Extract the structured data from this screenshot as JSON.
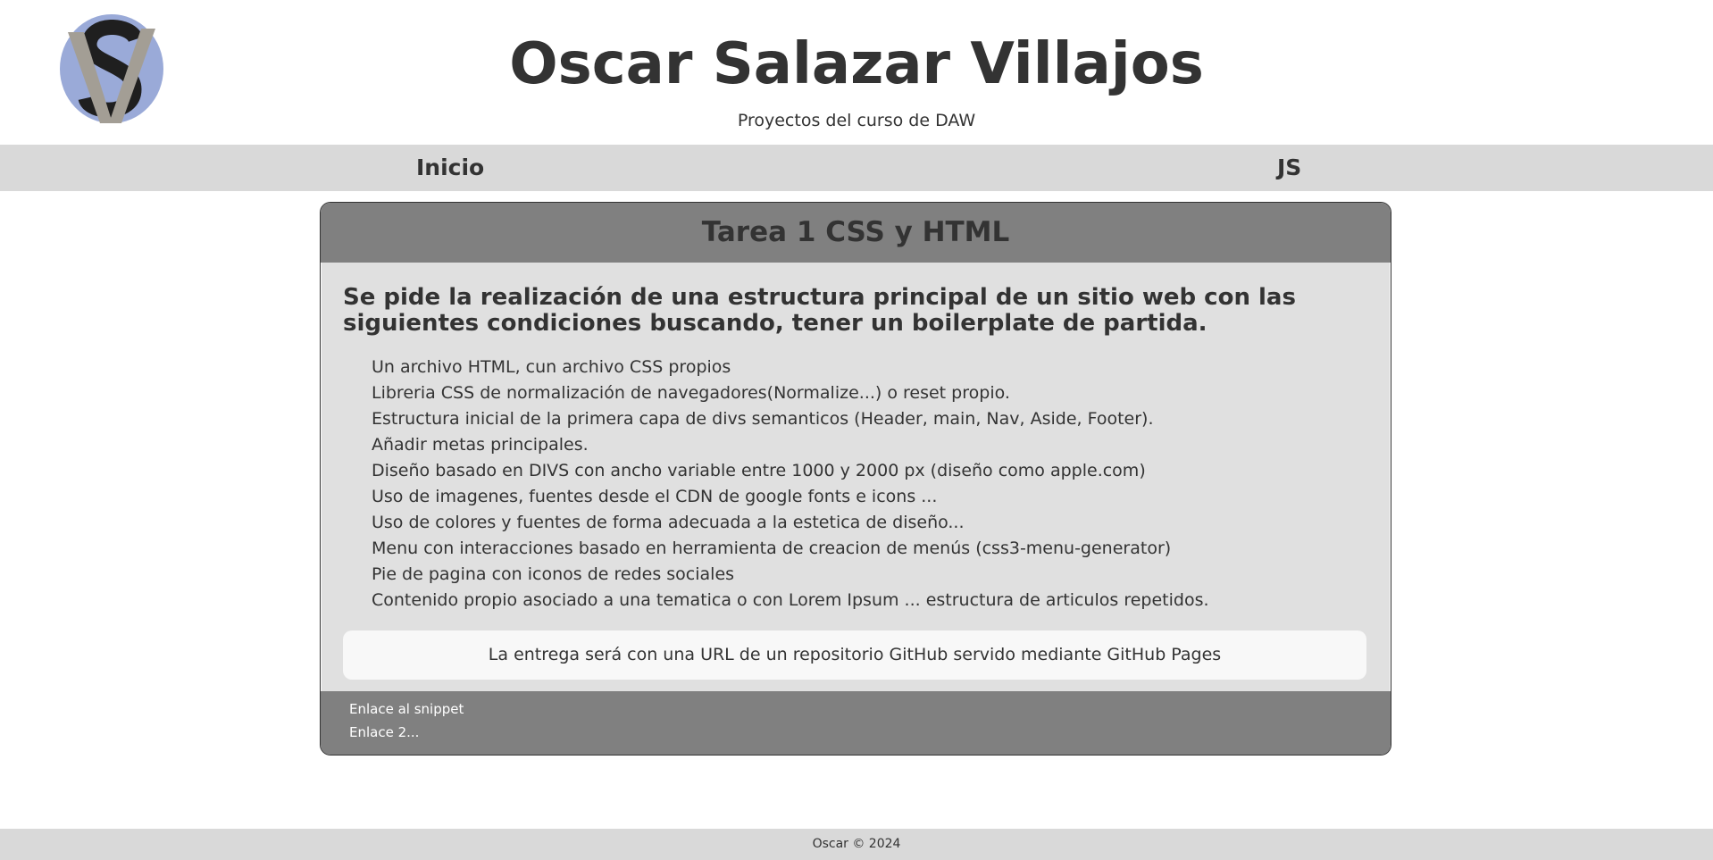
{
  "header": {
    "title": "Oscar Salazar Villajos",
    "subtitle": "Proyectos del curso de DAW",
    "logo_icon": "sv-monogram-logo"
  },
  "nav": {
    "items": [
      {
        "label": "Inicio"
      },
      {
        "label": "JS"
      }
    ]
  },
  "card": {
    "title": "Tarea 1 CSS y HTML",
    "intro": "Se pide la realización de una estructura principal de un sitio web con las siguientes condiciones buscando, tener un boilerplate de partida.",
    "requirements": [
      "Un archivo HTML, cun archivo CSS propios",
      "Libreria CSS de normalización de navegadores(Normalize...) o reset propio.",
      "Estructura inicial de la primera capa de divs semanticos (Header, main, Nav, Aside, Footer).",
      "Añadir metas principales.",
      "Diseño basado en DIVS con ancho variable entre 1000 y 2000 px (diseño como apple.com)",
      "Uso de imagenes, fuentes desde el CDN de google fonts e icons ...",
      "Uso de colores y fuentes de forma adecuada a la estetica de diseño...",
      "Menu con interacciones basado en herramienta de creacion de menús (css3-menu-generator)",
      "Pie de pagina con iconos de redes sociales",
      "Contenido propio asociado a una tematica o con Lorem Ipsum ... estructura de articulos repetidos."
    ],
    "delivery_note": "La entrega será con una URL de un repositorio GitHub servido mediante GitHub Pages",
    "links": [
      {
        "label": "Enlace al snippet"
      },
      {
        "label": "Enlace 2..."
      }
    ]
  },
  "footer": {
    "text": "Oscar © 2024"
  },
  "colors": {
    "text": "#333333",
    "nav_bg": "#d9d9d9",
    "card_bg": "#e0e0e0",
    "card_header_bg": "#808080",
    "logo_circle": "#9aaad8",
    "logo_v": "#a39e95",
    "logo_s": "#1f1f1f"
  }
}
